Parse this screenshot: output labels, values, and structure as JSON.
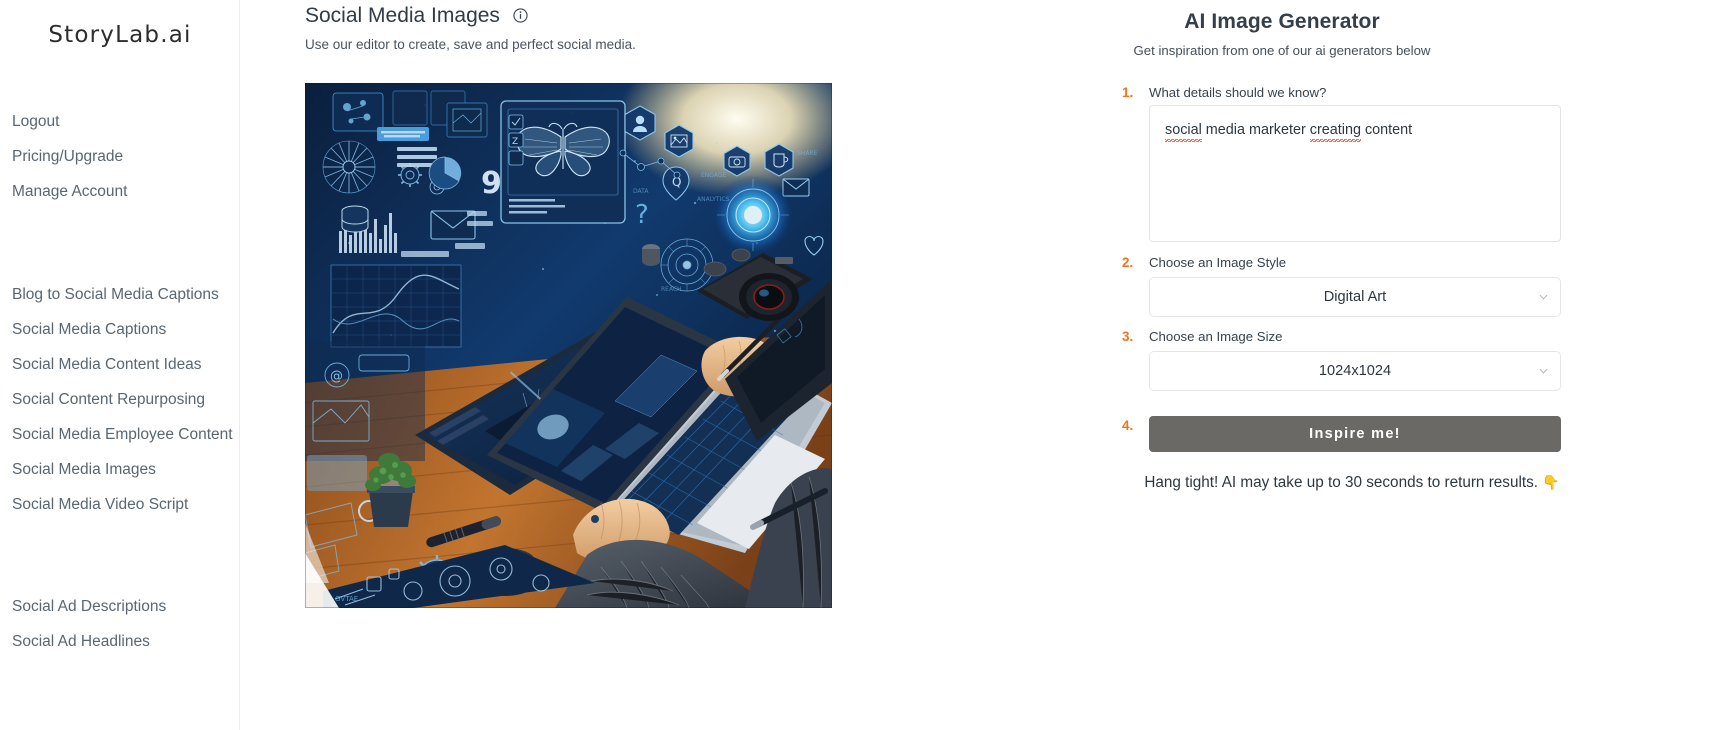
{
  "brand": {
    "name": "StoryLab.ai"
  },
  "sidebar": {
    "account": [
      {
        "label": "Logout",
        "name": "logout"
      },
      {
        "label": "Pricing/Upgrade",
        "name": "pricing-upgrade"
      },
      {
        "label": "Manage Account",
        "name": "manage-account"
      }
    ],
    "tools": [
      {
        "label": "Blog to Social Media Captions",
        "name": "blog-to-social-media-captions"
      },
      {
        "label": "Social Media Captions",
        "name": "social-media-captions"
      },
      {
        "label": "Social Media Content Ideas",
        "name": "social-media-content-ideas"
      },
      {
        "label": "Social Content Repurposing",
        "name": "social-content-repurposing"
      },
      {
        "label": "Social Media Employee Content",
        "name": "social-media-employee-content"
      },
      {
        "label": "Social Media Images",
        "name": "social-media-images"
      },
      {
        "label": "Social Media Video Script",
        "name": "social-media-video-script"
      }
    ],
    "ads": [
      {
        "label": "Social Ad Descriptions",
        "name": "social-ad-descriptions"
      },
      {
        "label": "Social Ad Headlines",
        "name": "social-ad-headlines"
      }
    ]
  },
  "page": {
    "title": "Social Media Images",
    "subtitle": "Use our editor to create, save and perfect social media.",
    "info_icon": "info-circle-icon"
  },
  "preview": {
    "alt": "AI generated digital art of a social media marketer creating content at a desk with laptop, camera and floating blue holographic social icons"
  },
  "generator": {
    "title": "AI Image Generator",
    "subtitle": "Get inspiration from one of our ai generators below",
    "steps": {
      "one": "1.",
      "two": "2.",
      "three": "3.",
      "four": "4."
    },
    "prompt": {
      "label": "What details should we know?",
      "value": "social media marketer creating content",
      "placeholder": "",
      "misspelled": [
        "social",
        "creating"
      ]
    },
    "style": {
      "label": "Choose an Image Style",
      "value": "Digital Art",
      "options": [
        "Digital Art"
      ]
    },
    "size": {
      "label": "Choose an Image Size",
      "value": "1024x1024",
      "options": [
        "1024x1024"
      ]
    },
    "submit_label": "Inspire me!",
    "hint": "Hang tight! AI may take up to 30 seconds to return results.",
    "hint_emoji": "👇"
  },
  "colors": {
    "accent_orange": "#f2741b",
    "button_gray": "#6b6966",
    "text_dark": "#313b45",
    "nav_text": "#5a6670",
    "border": "#e4e6e8"
  }
}
